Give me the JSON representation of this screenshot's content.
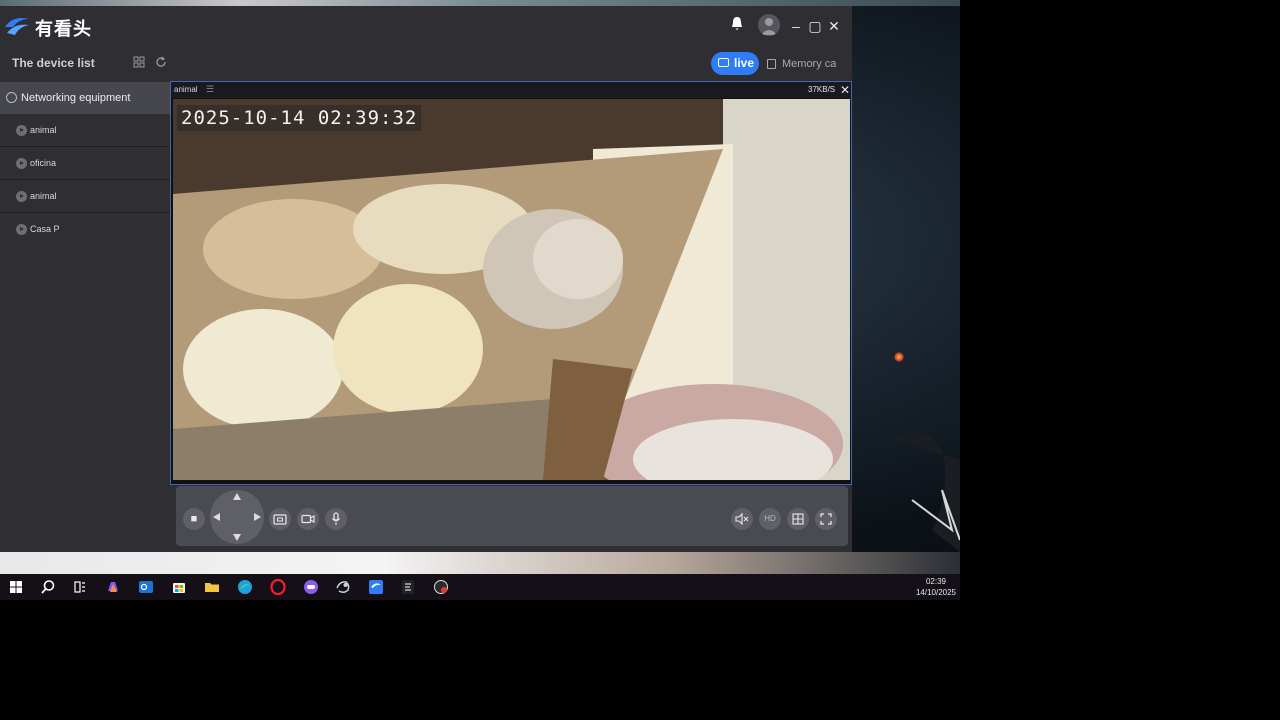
{
  "app": {
    "logo_text": "有看头",
    "icons": [
      "bell-icon",
      "user-avatar-icon",
      "minimize-icon",
      "maximize-icon",
      "close-icon"
    ]
  },
  "subbar": {
    "device_list_title": "The device list",
    "live_label": "live",
    "memory_label": "Memory card"
  },
  "sidebar": {
    "group_label": "Networking equipment",
    "devices": [
      {
        "label": "animal"
      },
      {
        "label": "oficina"
      },
      {
        "label": "animal"
      },
      {
        "label": "Casa P"
      }
    ]
  },
  "video": {
    "title": "animal",
    "bitrate": "37KB/S",
    "timestamp": "2025-10-14  02:39:32"
  },
  "controls": {
    "left_icons": [
      "stop-icon",
      "ptz-pad",
      "screenshot-icon",
      "record-icon",
      "microphone-icon"
    ],
    "right_icons": [
      "mute-icon",
      "hd-icon",
      "grid-layout-icon",
      "fullscreen-icon"
    ],
    "hd_label": "HD"
  },
  "taskbar": {
    "time": "02:39",
    "date": "14/10/2025"
  }
}
